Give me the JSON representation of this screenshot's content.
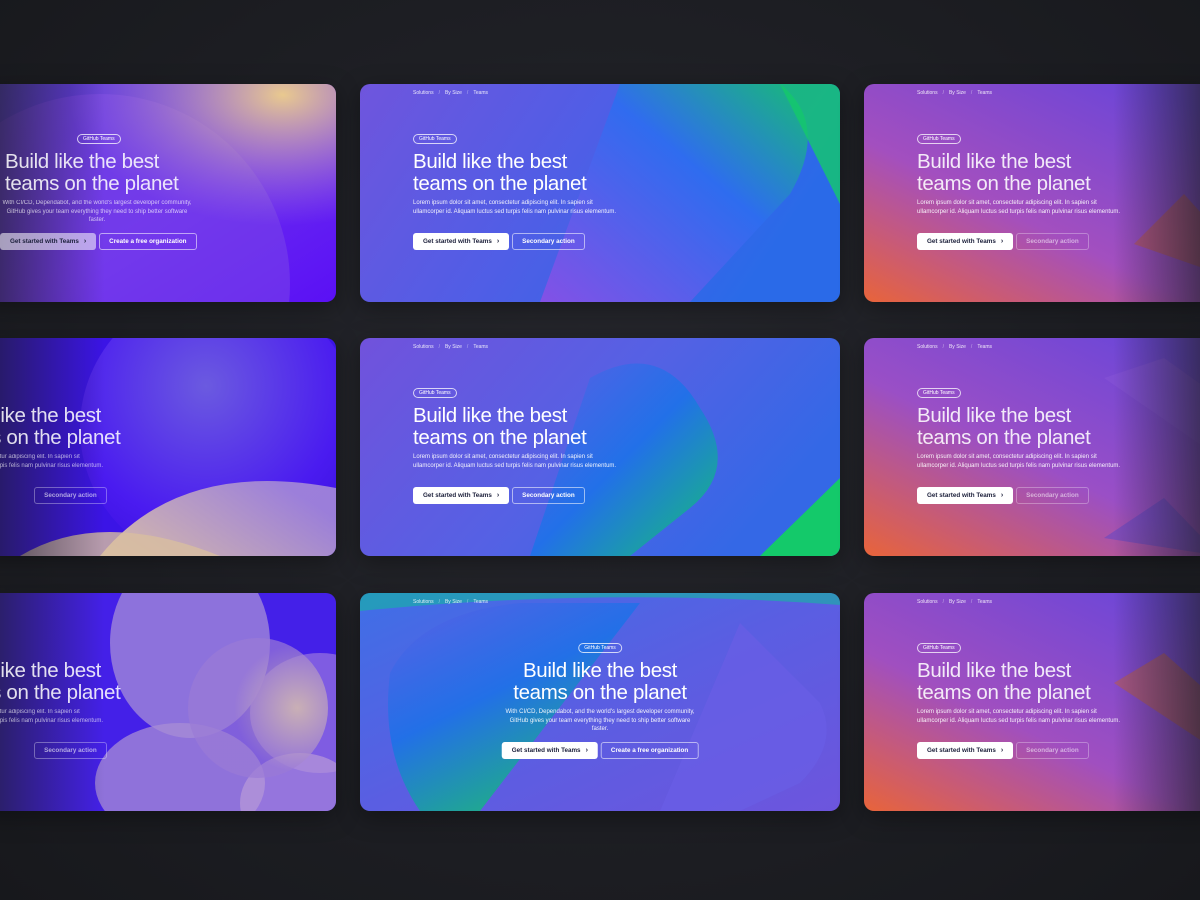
{
  "breadcrumbs": [
    "Solutions",
    "By Size",
    "Teams"
  ],
  "pill": "GitHub Teams",
  "heading_line1": "Build like the best",
  "heading_line2": "teams on the planet",
  "desc_lorem": "Lorem ipsum dolor sit amet, consectetur adipiscing elit. In sapien sit ullamcorper id. Aliquam luctus sed turpis felis nam pulvinar risus elementum.",
  "desc_github": "With CI/CD, Dependabot, and the world's largest developer community, GitHub gives your team everything they need to ship better software faster.",
  "btn_primary": "Get started with Teams",
  "btn_secondary": "Secondary action",
  "btn_free_org": "Create a free organization",
  "icons": {
    "button_chevron": "chevron-right-icon"
  },
  "colors": {
    "page_background": "#1d1e23",
    "violet": "#7b4fe0",
    "blue": "#1a6fe8",
    "green": "#12c46a",
    "orange": "#e8643a",
    "cream": "#e8d7a6"
  }
}
